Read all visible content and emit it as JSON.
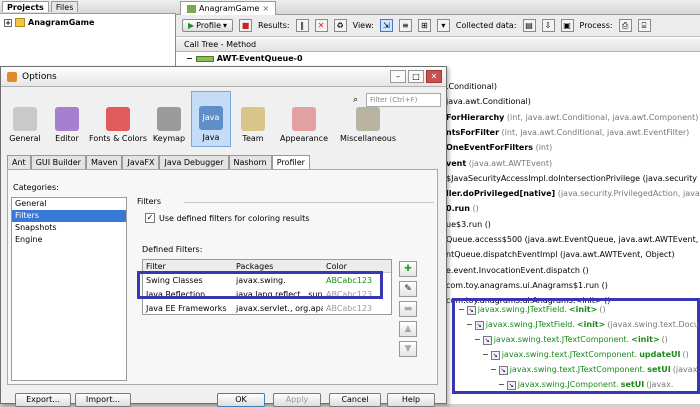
{
  "projects": {
    "tabs": [
      "Projects",
      "Files"
    ],
    "root": "AnagramGame"
  },
  "editor": {
    "tab": "AnagramGame",
    "toolbar": {
      "profile_label": "Profile",
      "results_label": "Results:",
      "view_label": "View:",
      "collected_label": "Collected data:",
      "process_label": "Process:"
    },
    "column_header": "Call Tree - Method",
    "thread": "AWT-EventQueue-0",
    "lines": [
      {
        "bold": "",
        "rest": ".Conditional)"
      },
      {
        "bold": "",
        "rest": "java.awt.Conditional)"
      },
      {
        "bold": "ForHierarchy",
        "rest": " (int, java.awt.Conditional, java.awt.Component)"
      },
      {
        "bold": "ntsForFilter",
        "rest": " (int, java.awt.Conditional, java.awt.EventFilter)"
      },
      {
        "bold": "OneEventForFilters",
        "rest": " (int)"
      },
      {
        "bold": "vent",
        "rest": " (java.awt.AWTEvent)"
      },
      {
        "bold": "",
        "rest": "$JavaSecurityAccessImpl.doIntersectionPrivilege (java.security"
      },
      {
        "bold": "ller.doPrivileged[native]",
        "rest": " (java.security.PrivilegedAction, java.se"
      },
      {
        "bold": "0.run",
        "rest": " ()"
      },
      {
        "bold": "",
        "rest": "ue$3.run ()"
      },
      {
        "bold": "",
        "rest": "Queue.access$500 (java.awt.EventQueue, java.awt.AWTEvent,"
      },
      {
        "bold": "",
        "rest": "ntQueue.dispatchEventImpl (java.awt.AWTEvent, Object)"
      },
      {
        "bold": "",
        "rest": "e.event.InvocationEvent.dispatch ()"
      },
      {
        "bold": "",
        "rest": "com.toy.anagrams.ui.Anagrams$1.run ()"
      },
      {
        "bold": "",
        "rest": "com.toy.anagrams.ui.Anagrams.<init> ()"
      }
    ],
    "highlighted": [
      {
        "green": "javax.swing.JTextField.",
        "bold": "<init>",
        "rest": " ()"
      },
      {
        "green": "javax.swing.JTextField.",
        "bold": "<init>",
        "rest": " (javax.swing.text.Docu"
      },
      {
        "green": "javax.swing.text.JTextComponent.",
        "bold": "<init>",
        "rest": " ()"
      },
      {
        "green": "javax.swing.text.JTextComponent.",
        "bold": "updateUI",
        "rest": " ()"
      },
      {
        "green": "javax.swing.text.JTextComponent.",
        "bold": "setUI",
        "rest": " (javax.sw"
      },
      {
        "green": "javax.swing.JComponent.",
        "bold": "setUI",
        "rest": " (javax."
      }
    ]
  },
  "options": {
    "title": "Options",
    "categories": [
      "General",
      "Editor",
      "Fonts & Colors",
      "Keymap",
      "Java",
      "Team",
      "Appearance",
      "Miscellaneous"
    ],
    "selected_category": "Java",
    "filter_placeholder": "Filter (Ctrl+F)",
    "subtabs": [
      "Ant",
      "GUI Builder",
      "Maven",
      "JavaFX",
      "Java Debugger",
      "Nashorn",
      "Profiler"
    ],
    "selected_subtab": "Profiler",
    "categories_label": "Categories:",
    "left_items": [
      "General",
      "Filters",
      "Snapshots",
      "Engine"
    ],
    "selected_left": "Filters",
    "filters_title": "Filters",
    "use_defined_label": "Use defined filters for coloring results",
    "defined_filters_label": "Defined Filters:",
    "table_headers": [
      "Filter",
      "Packages",
      "Color"
    ],
    "rows": [
      {
        "filter": "Swing Classes",
        "packages": "javax.swing.",
        "color": "ABCabc123"
      },
      {
        "filter": "Java Reflection",
        "packages": "java.lang.reflect., sun.",
        "color": "ABCabc123"
      },
      {
        "filter": "Java EE Frameworks",
        "packages": "javax.servlet., org.apa",
        "color": "ABCabc123"
      }
    ],
    "buttons": {
      "export": "Export...",
      "import": "Import...",
      "ok": "OK",
      "apply": "Apply",
      "cancel": "Cancel",
      "help": "Help"
    },
    "colors": {
      "selection": "#3a78d6",
      "highlight_box": "#3537b4",
      "swing_color": "#1a8a1a"
    }
  }
}
